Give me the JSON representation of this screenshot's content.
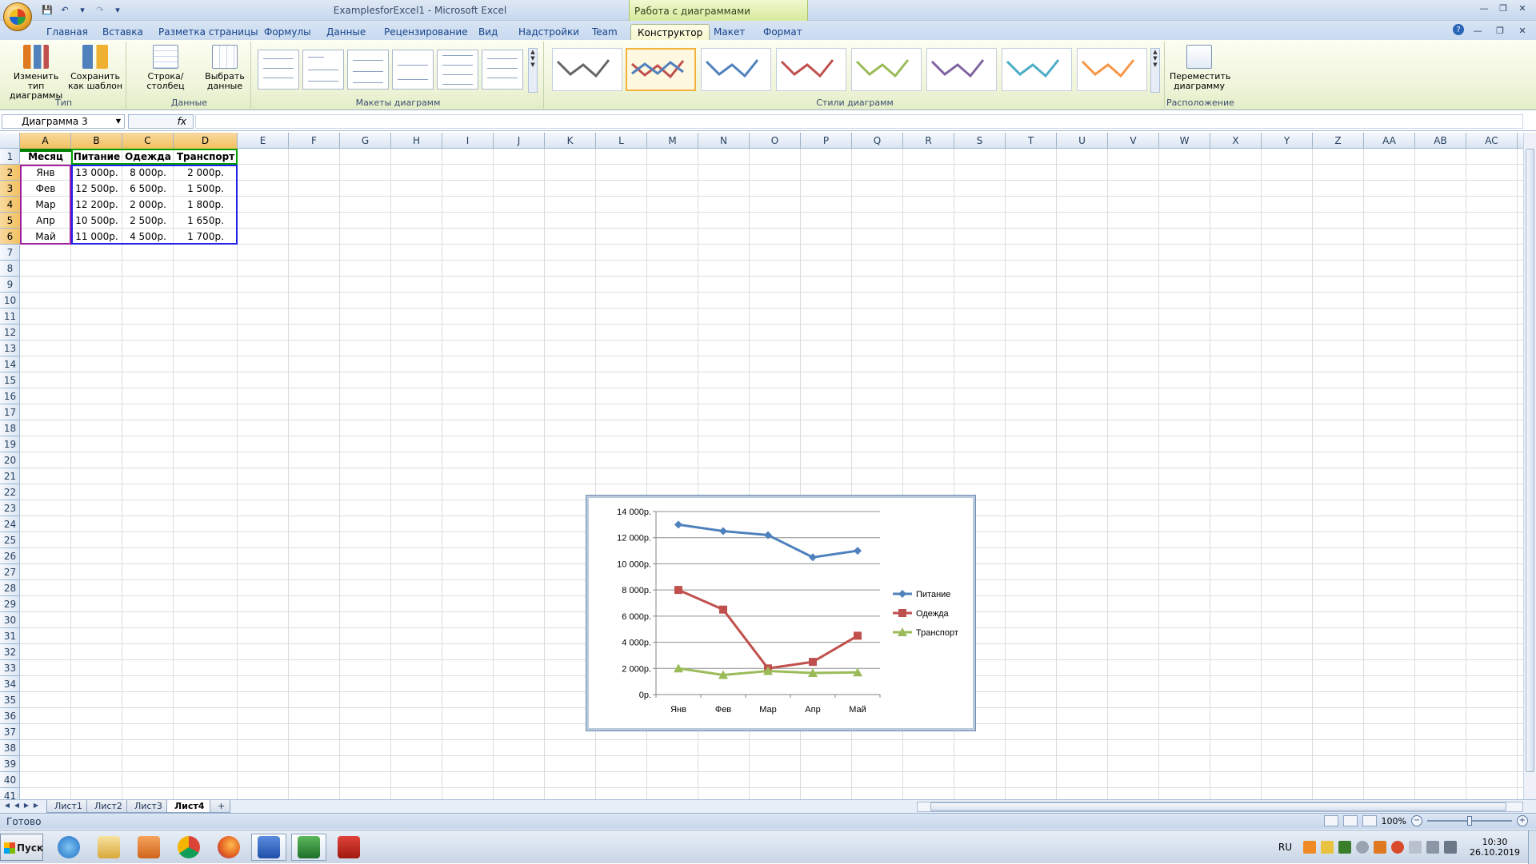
{
  "window": {
    "title": "ExamplesforExcel1  -  Microsoft Excel",
    "context_title": "Работа с диаграммами"
  },
  "tabs": [
    "Главная",
    "Вставка",
    "Разметка страницы",
    "Формулы",
    "Данные",
    "Рецензирование",
    "Вид",
    "Надстройки",
    "Team",
    "Конструктор",
    "Макет",
    "Формат"
  ],
  "active_tab": "Конструктор",
  "ribbon": {
    "change_type": "Изменить тип диаграммы",
    "save_template": "Сохранить как шаблон",
    "group_type": "Тип",
    "switch_row_col": "Строка/столбец",
    "select_data": "Выбрать данные",
    "group_data": "Данные",
    "group_layouts": "Макеты диаграмм",
    "group_styles": "Стили диаграмм",
    "move_chart": "Переместить диаграмму",
    "group_location": "Расположение",
    "style_colors": [
      "#666666",
      "#4f81bd",
      "#4f81bd",
      "#c0504d",
      "#9bbb59",
      "#8064a2",
      "#4bacc6",
      "#f79646"
    ]
  },
  "formula_bar": {
    "name_box": "Диаграмма 3",
    "fx": "fx",
    "formula": ""
  },
  "columns": [
    "A",
    "B",
    "C",
    "D",
    "E",
    "F",
    "G",
    "H",
    "I",
    "J",
    "K",
    "L",
    "M",
    "N",
    "O",
    "P",
    "Q",
    "R",
    "S",
    "T",
    "U",
    "V",
    "W",
    "X",
    "Y",
    "Z",
    "AA",
    "AB",
    "AC"
  ],
  "rows": [
    "1",
    "2",
    "3",
    "4",
    "5",
    "6",
    "7",
    "8",
    "9",
    "10",
    "11",
    "12",
    "13",
    "14",
    "15",
    "16",
    "17",
    "18",
    "19",
    "20",
    "21",
    "22",
    "23",
    "24",
    "25",
    "26",
    "27",
    "28",
    "29",
    "30",
    "31",
    "32",
    "33",
    "34",
    "35",
    "36",
    "37",
    "38",
    "39",
    "40",
    "41"
  ],
  "table": {
    "headers": [
      "Месяц",
      "Питание",
      "Одежда",
      "Транспорт"
    ],
    "rows": [
      [
        "Янв",
        "13 000р.",
        "8 000р.",
        "2 000р."
      ],
      [
        "Фев",
        "12 500р.",
        "6 500р.",
        "1 500р."
      ],
      [
        "Мар",
        "12 200р.",
        "2 000р.",
        "1 800р."
      ],
      [
        "Апр",
        "10 500р.",
        "2 500р.",
        "1 650р."
      ],
      [
        "Май",
        "11 000р.",
        "4 500р.",
        "1 700р."
      ]
    ]
  },
  "chart_data": {
    "type": "line",
    "categories": [
      "Янв",
      "Фев",
      "Мар",
      "Апр",
      "Май"
    ],
    "series": [
      {
        "name": "Питание",
        "values": [
          13000,
          12500,
          12200,
          10500,
          11000
        ],
        "color": "#4f81bd",
        "marker": "diamond"
      },
      {
        "name": "Одежда",
        "values": [
          8000,
          6500,
          2000,
          2500,
          4500
        ],
        "color": "#c0504d",
        "marker": "square"
      },
      {
        "name": "Транспорт",
        "values": [
          2000,
          1500,
          1800,
          1650,
          1700
        ],
        "color": "#9bbb59",
        "marker": "triangle"
      }
    ],
    "y_ticks": [
      "0р.",
      "2 000р.",
      "4 000р.",
      "6 000р.",
      "8 000р.",
      "10 000р.",
      "12 000р.",
      "14 000р."
    ],
    "ylim": [
      0,
      14000
    ],
    "grid": true,
    "legend": "right"
  },
  "sheets": [
    "Лист1",
    "Лист2",
    "Лист3",
    "Лист4"
  ],
  "active_sheet": "Лист4",
  "status": {
    "ready": "Готово",
    "zoom": "100%",
    "zoom_level": 1.0
  },
  "taskbar": {
    "start": "Пуск",
    "lang": "RU",
    "time": "10:30",
    "date": "26.10.2019"
  }
}
